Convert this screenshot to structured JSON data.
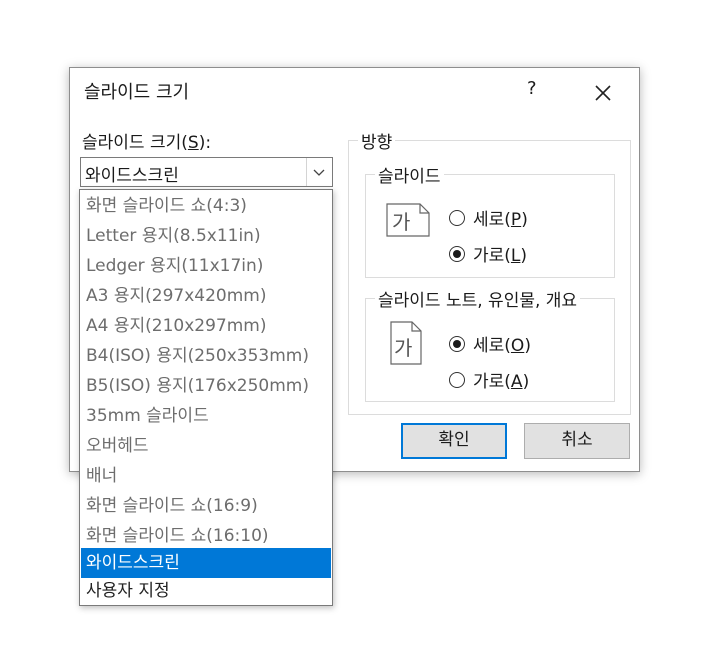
{
  "dialog": {
    "title": "슬라이드 크기",
    "help_label": "?",
    "size_label_prefix": "슬라이드 크기(",
    "size_label_key": "S",
    "size_label_suffix": "):",
    "selected_size": "와이드스크린",
    "ok_label": "확인",
    "cancel_label": "취소"
  },
  "orientation": {
    "legend": "방향",
    "slides": {
      "legend": "슬라이드",
      "icon_glyph": "가",
      "portrait_prefix": "세로(",
      "portrait_key": "P",
      "portrait_suffix": ")",
      "landscape_prefix": "가로(",
      "landscape_key": "L",
      "landscape_suffix": ")",
      "selected": "landscape"
    },
    "notes": {
      "legend": "슬라이드 노트, 유인물, 개요",
      "icon_glyph": "가",
      "portrait_prefix": "세로(",
      "portrait_key": "O",
      "portrait_suffix": ")",
      "landscape_prefix": "가로(",
      "landscape_key": "A",
      "landscape_suffix": ")",
      "selected": "portrait"
    }
  },
  "dropdown": {
    "options": [
      "화면 슬라이드 쇼(4:3)",
      "Letter 용지(8.5x11in)",
      "Ledger 용지(11x17in)",
      "A3 용지(297x420mm)",
      "A4 용지(210x297mm)",
      "B4(ISO) 용지(250x353mm)",
      "B5(ISO) 용지(176x250mm)",
      "35mm 슬라이드",
      "오버헤드",
      "배너",
      "화면 슬라이드 쇼(16:9)",
      "화면 슬라이드 쇼(16:10)",
      "와이드스크린",
      "사용자 지정"
    ],
    "selected_index": 12
  },
  "colors": {
    "accent": "#0078d7",
    "border": "#7a7a7a",
    "button_bg": "#e1e1e1"
  }
}
